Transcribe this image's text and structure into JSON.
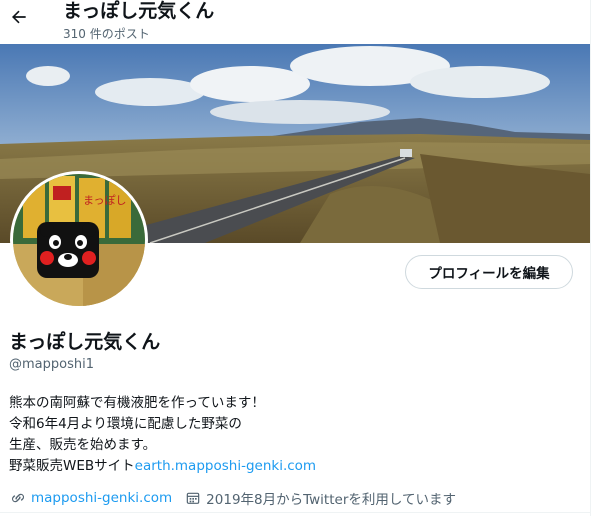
{
  "header": {
    "title": "まっぽし元気くん",
    "post_count": "310 件のポスト",
    "back_icon": "arrow-left-icon"
  },
  "profile": {
    "display_name": "まっぽし元気くん",
    "handle": "@mapposhi1",
    "edit_button_label": "プロフィールを編集",
    "bio_lines": [
      "熊本の南阿蘇で有機液肥を作っています！",
      "令和6年4月より環境に配慮した野菜の",
      "生産、販売を始めます。"
    ],
    "bio_last_prefix": "野菜販売WEBサイト",
    "bio_link": "earth.mapposhi-genki.com",
    "website": "mapposhi-genki.com",
    "joined": "2019年8月からTwitterを利用しています",
    "avatar_product_text": "まっぽし"
  },
  "colors": {
    "link": "#1d9bf0",
    "secondary_text": "#536471",
    "border": "#cfd9de"
  },
  "icons": {
    "website": "link-icon",
    "joined": "calendar-icon"
  }
}
